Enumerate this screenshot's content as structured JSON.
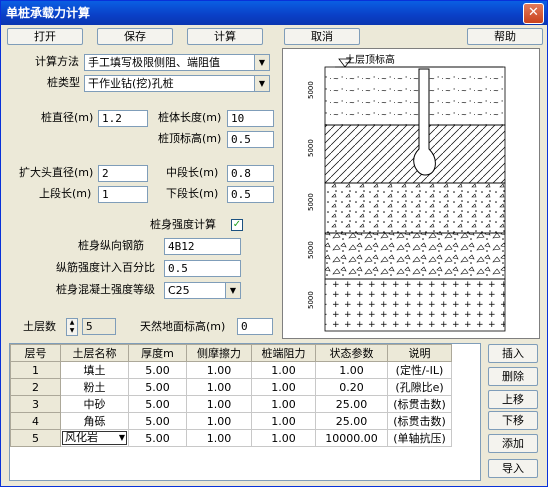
{
  "window": {
    "title": "单桩承载力计算",
    "close": "✕"
  },
  "toolbar": {
    "open": "打开",
    "save": "保存",
    "calc": "计算",
    "cancel": "取消",
    "help": "帮助"
  },
  "form": {
    "calc_method_label": "计算方法",
    "calc_method_value": "手工填写极限侧阻、端阻值",
    "pile_type_label": "桩类型",
    "pile_type_value": "干作业钻(挖)孔桩",
    "diameter_label": "桩直径(m)",
    "diameter_value": "1.2",
    "length_label": "桩体长度(m)",
    "length_value": "10",
    "top_elev_label": "桩顶标高(m)",
    "top_elev_value": "0.5",
    "enlarge_dia_label": "扩大头直径(m)",
    "enlarge_dia_value": "2",
    "mid_len_label": "中段长(m)",
    "mid_len_value": "0.8",
    "upper_len_label": "上段长(m)",
    "upper_len_value": "1",
    "lower_len_label": "下段长(m)",
    "lower_len_value": "0.5",
    "strength_calc_label": "桩身强度计算",
    "strength_calc_checked": "✓",
    "rebar_label": "桩身纵向钢筋",
    "rebar_value": "4B12",
    "rebar_pct_label": "纵筋强度计入百分比",
    "rebar_pct_value": "0.5",
    "concrete_label": "桩身混凝土强度等级",
    "concrete_value": "C25",
    "layers_label": "土层数",
    "layers_value": "5",
    "ground_elev_label": "天然地面标高(m)",
    "ground_elev_value": "0"
  },
  "diagram": {
    "top_label": "土层顶标高",
    "depth_labels": [
      "5000",
      "5000",
      "5000",
      "5000",
      "5000"
    ]
  },
  "table": {
    "headers": [
      "层号",
      "土层名称",
      "厚度m",
      "侧摩擦力",
      "桩端阻力",
      "状态参数",
      "说明"
    ],
    "rows": [
      [
        "1",
        "填土",
        "5.00",
        "1.00",
        "1.00",
        "1.00",
        "(定性/-IL)"
      ],
      [
        "2",
        "粉土",
        "5.00",
        "1.00",
        "1.00",
        "0.20",
        "(孔隙比e)"
      ],
      [
        "3",
        "中砂",
        "5.00",
        "1.00",
        "1.00",
        "25.00",
        "(标贯击数)"
      ],
      [
        "4",
        "角砾",
        "5.00",
        "1.00",
        "1.00",
        "25.00",
        "(标贯击数)"
      ],
      [
        "5",
        "风化岩",
        "5.00",
        "1.00",
        "1.00",
        "10000.00",
        "(单轴抗压)"
      ]
    ]
  },
  "side_buttons": {
    "insert": "插入",
    "delete": "删除",
    "up": "上移",
    "down": "下移",
    "add": "添加",
    "import": "导入"
  }
}
